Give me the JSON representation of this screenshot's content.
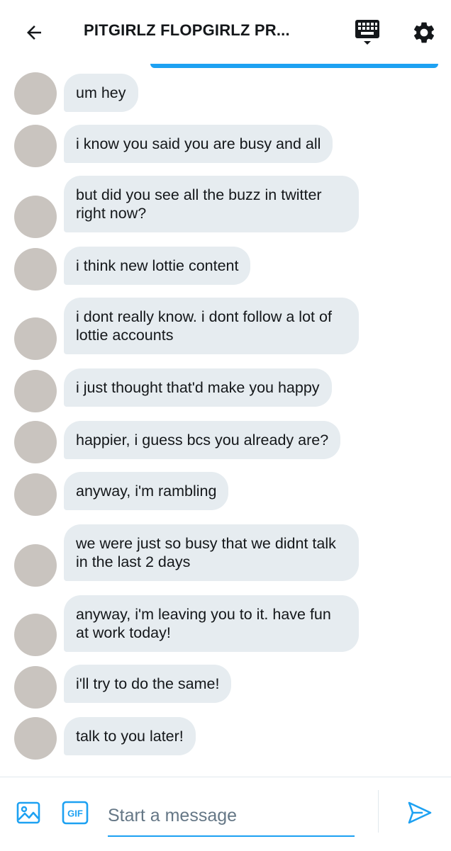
{
  "header": {
    "title": "PITGIRLZ FLOPGIRLZ PR...",
    "back_icon": "back-arrow-icon",
    "keyboard_icon": "keyboard-icon",
    "settings_icon": "gear-icon"
  },
  "colors": {
    "accent": "#1da1f2",
    "bubble": "#e6ecf0",
    "text": "#14171a",
    "placeholder": "#657786"
  },
  "messages": [
    {
      "text": "um hey"
    },
    {
      "text": "i know you said you are busy and all"
    },
    {
      "text": "but did you see all the buzz in twitter right now?"
    },
    {
      "text": "i think new lottie content"
    },
    {
      "text": "i dont really know. i dont follow a lot of lottie accounts"
    },
    {
      "text": "i just thought that'd make you happy"
    },
    {
      "text": "happier, i guess bcs you already are?"
    },
    {
      "text": "anyway, i'm rambling"
    },
    {
      "text": "we were just so busy that we didnt talk in the last 2 days"
    },
    {
      "text": "anyway, i'm leaving you to it. have fun at work today!"
    },
    {
      "text": "i'll try to do the same!"
    },
    {
      "text": "talk to you later!"
    }
  ],
  "composer": {
    "placeholder": "Start a message",
    "value": "",
    "image_icon": "image-icon",
    "gif_label": "GIF",
    "send_icon": "send-icon"
  }
}
